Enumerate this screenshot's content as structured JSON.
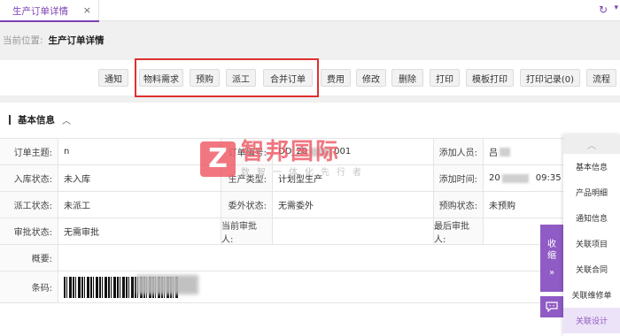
{
  "tab": {
    "label": "生产订单详情",
    "close": "×"
  },
  "breadcrumb": {
    "label": "当前位置:",
    "value": "生产订单详情"
  },
  "toolbar": {
    "buttons": [
      "通知",
      "物料需求",
      "预购",
      "派工",
      "合并订单",
      "费用",
      "修改",
      "删除",
      "打印",
      "模板打印",
      "打印记录(0)",
      "流程"
    ]
  },
  "section": {
    "title": "基本信息"
  },
  "fields": {
    "r1": {
      "l1": "订单主题:",
      "v1": "n",
      "l2": "订单编号:",
      "v2a": "DD_20",
      "v2b": "001",
      "l3": "添加人员:",
      "v3": "吕"
    },
    "r2": {
      "l1": "入库状态:",
      "v1": "未入库",
      "l2": "生产类型:",
      "v2": "计划型生产",
      "l3": "添加时间:",
      "v3a": "20",
      "v3b": "09:35"
    },
    "r3": {
      "l1": "派工状态:",
      "v1": "未派工",
      "l2": "委外状态:",
      "v2": "无需委外",
      "l3": "预购状态:",
      "v3": "未预购"
    },
    "r4": {
      "l1": "审批状态:",
      "v1": "无需审批",
      "l2": "当前审批人:",
      "v2": "",
      "l3": "最后审批人:",
      "v3": ""
    },
    "r5": {
      "l1": "概要:",
      "v1": ""
    },
    "r6": {
      "l1": "条码:"
    }
  },
  "watermark": {
    "logo": "Z",
    "title": "智邦国际",
    "subtitle": "数智一体化先行者"
  },
  "side_panel": {
    "collapse_label_1": "收",
    "collapse_label_2": "缩",
    "collapse_arrow": "»",
    "chat_icon": "chat-icon",
    "items": [
      "基本信息",
      "产品明细",
      "通知信息",
      "关联项目",
      "关联合同",
      "关联维修单",
      "关联设计"
    ],
    "active_index": 6
  },
  "colors": {
    "accent": "#8f5bc4",
    "tab_accent": "#7b3fb0",
    "highlight": "#e03030",
    "watermark": "#f05f6a"
  }
}
